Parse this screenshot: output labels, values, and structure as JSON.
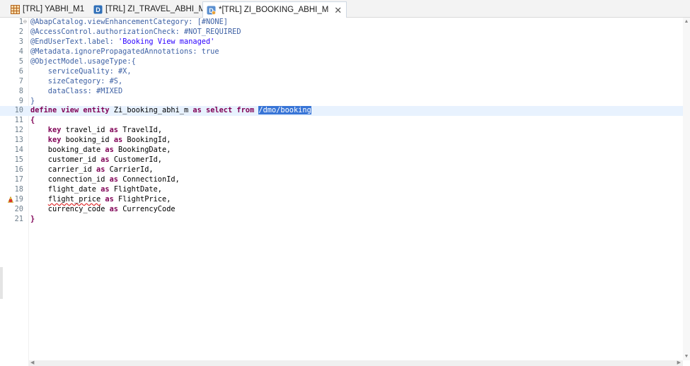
{
  "tabs": [
    {
      "label": "[TRL] YABHI_M1",
      "icon": "table-grid-icon",
      "active": false
    },
    {
      "label": "[TRL] ZI_TRAVEL_ABHI_M",
      "icon": "ddl-entity-icon",
      "active": false
    },
    {
      "label": "*[TRL] ZI_BOOKING_ABHI_M",
      "icon": "cds-view-icon",
      "active": true,
      "close": "✕"
    }
  ],
  "editor": {
    "current_line": 10,
    "lines": [
      {
        "n": "1",
        "fold": "⊖",
        "tokens": [
          {
            "t": "@AbapCatalog.viewEnhancementCategory: [#NONE]",
            "c": "ann"
          }
        ]
      },
      {
        "n": "2",
        "tokens": [
          {
            "t": "@AccessControl.authorizationCheck: #NOT_REQUIRED",
            "c": "ann"
          }
        ]
      },
      {
        "n": "3",
        "tokens": [
          {
            "t": "@EndUserText.label: ",
            "c": "ann"
          },
          {
            "t": "'Booking View managed'",
            "c": "str"
          }
        ]
      },
      {
        "n": "4",
        "tokens": [
          {
            "t": "@Metadata.ignorePropagatedAnnotations: true",
            "c": "ann"
          }
        ]
      },
      {
        "n": "5",
        "tokens": [
          {
            "t": "@ObjectModel.usageType:{",
            "c": "ann"
          }
        ]
      },
      {
        "n": "6",
        "tokens": [
          {
            "t": "    serviceQuality: #X,",
            "c": "ann"
          }
        ]
      },
      {
        "n": "7",
        "tokens": [
          {
            "t": "    sizeCategory: #S,",
            "c": "ann"
          }
        ]
      },
      {
        "n": "8",
        "tokens": [
          {
            "t": "    dataClass: #MIXED",
            "c": "ann"
          }
        ]
      },
      {
        "n": "9",
        "tokens": [
          {
            "t": "}",
            "c": "ann"
          }
        ]
      },
      {
        "n": "10",
        "tokens": [
          {
            "t": "define view entity ",
            "c": "kw"
          },
          {
            "t": "Zi_booking_abhi_m ",
            "c": "id"
          },
          {
            "t": "as select from ",
            "c": "kw"
          },
          {
            "t": "/dmo/booking",
            "c": "sel"
          }
        ]
      },
      {
        "n": "11",
        "tokens": [
          {
            "t": "{",
            "c": "kw"
          }
        ]
      },
      {
        "n": "12",
        "tokens": [
          {
            "t": "    key ",
            "c": "kw"
          },
          {
            "t": "travel_id ",
            "c": "id"
          },
          {
            "t": "as ",
            "c": "kw"
          },
          {
            "t": "TravelId,",
            "c": "id"
          }
        ]
      },
      {
        "n": "13",
        "tokens": [
          {
            "t": "    key ",
            "c": "kw"
          },
          {
            "t": "booking_id ",
            "c": "id"
          },
          {
            "t": "as ",
            "c": "kw"
          },
          {
            "t": "BookingId,",
            "c": "id"
          }
        ]
      },
      {
        "n": "14",
        "tokens": [
          {
            "t": "    booking_date ",
            "c": "id"
          },
          {
            "t": "as ",
            "c": "kw"
          },
          {
            "t": "BookingDate,",
            "c": "id"
          }
        ]
      },
      {
        "n": "15",
        "tokens": [
          {
            "t": "    customer_id ",
            "c": "id"
          },
          {
            "t": "as ",
            "c": "kw"
          },
          {
            "t": "CustomerId,",
            "c": "id"
          }
        ]
      },
      {
        "n": "16",
        "tokens": [
          {
            "t": "    carrier_id ",
            "c": "id"
          },
          {
            "t": "as ",
            "c": "kw"
          },
          {
            "t": "CarrierId,",
            "c": "id"
          }
        ]
      },
      {
        "n": "17",
        "tokens": [
          {
            "t": "    connection_id ",
            "c": "id"
          },
          {
            "t": "as ",
            "c": "kw"
          },
          {
            "t": "ConnectionId,",
            "c": "id"
          }
        ]
      },
      {
        "n": "18",
        "tokens": [
          {
            "t": "    flight_date ",
            "c": "id"
          },
          {
            "t": "as ",
            "c": "kw"
          },
          {
            "t": "FlightDate,",
            "c": "id"
          }
        ]
      },
      {
        "n": "19",
        "marker": "warning-error-icon",
        "tokens": [
          {
            "t": "    ",
            "c": "id"
          },
          {
            "t": "flight_price",
            "c": "err"
          },
          {
            "t": " ",
            "c": "id"
          },
          {
            "t": "as ",
            "c": "kw"
          },
          {
            "t": "FlightPrice,",
            "c": "id"
          }
        ]
      },
      {
        "n": "20",
        "tokens": [
          {
            "t": "    currency_code ",
            "c": "id"
          },
          {
            "t": "as ",
            "c": "kw"
          },
          {
            "t": "CurrencyCode",
            "c": "id"
          }
        ]
      },
      {
        "n": "21",
        "tokens": [
          {
            "t": "}",
            "c": "kw"
          }
        ]
      }
    ]
  },
  "colors": {
    "annotation": "#3f62a5",
    "keyword": "#7f0055",
    "string": "#2a00ff",
    "selection": "#3875d7",
    "current_line": "#e8f2fe"
  }
}
